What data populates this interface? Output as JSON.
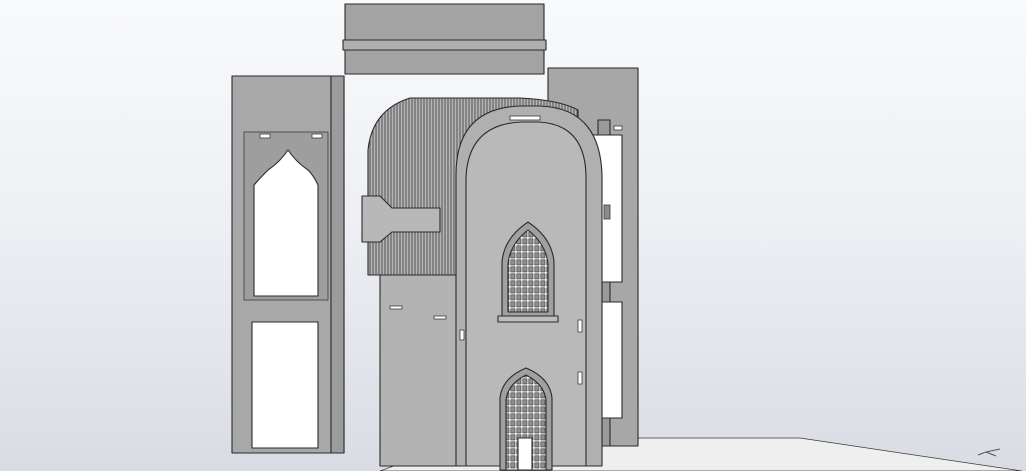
{
  "scene": {
    "background_top": "#f7f8fb",
    "background_bottom": "#d8dbe2",
    "part_fill": "#a6a6a6",
    "part_fill_light": "#bdbdbd",
    "part_fill_dark": "#8c8c8c",
    "edge_color": "#2a2a2a",
    "window_fill": "#ffffff",
    "floor_fill": "#eeeeee",
    "orientation_triad": "axis-triad-icon"
  }
}
